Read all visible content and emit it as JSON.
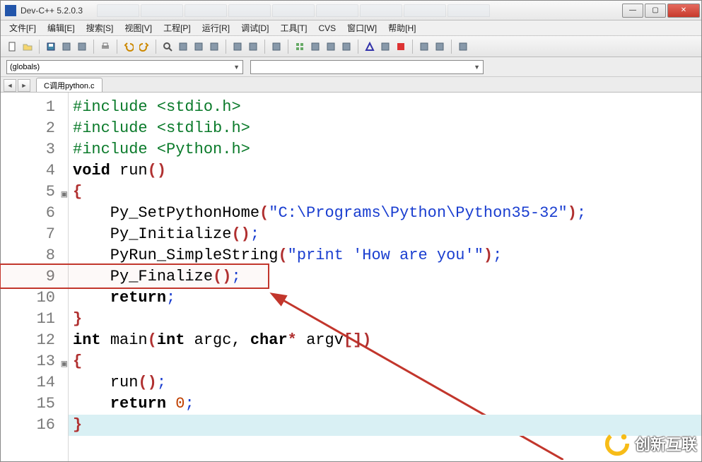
{
  "window": {
    "title": "Dev-C++ 5.2.0.3",
    "min": "—",
    "max": "▢",
    "close": "✕"
  },
  "menu": {
    "file": "文件[F]",
    "edit": "编辑[E]",
    "search": "搜索[S]",
    "view": "视图[V]",
    "project": "工程[P]",
    "run": "运行[R]",
    "debug": "调试[D]",
    "tools": "工具[T]",
    "cvs": "CVS",
    "window": "窗口[W]",
    "help": "帮助[H]"
  },
  "combos": {
    "globals": "(globals)",
    "members": ""
  },
  "tab": {
    "filename": "C调用python.c"
  },
  "lines": [
    {
      "n": "1",
      "fold": false,
      "tokens": [
        [
          "pre",
          "#include "
        ],
        [
          "pre",
          "<stdio.h>"
        ]
      ]
    },
    {
      "n": "2",
      "fold": false,
      "tokens": [
        [
          "pre",
          "#include "
        ],
        [
          "pre",
          "<stdlib.h>"
        ]
      ]
    },
    {
      "n": "3",
      "fold": false,
      "tokens": [
        [
          "pre",
          "#include "
        ],
        [
          "pre",
          "<Python.h>"
        ]
      ]
    },
    {
      "n": "4",
      "fold": false,
      "tokens": [
        [
          "kw",
          "void "
        ],
        [
          "fn",
          "run"
        ],
        [
          "paren",
          "()"
        ]
      ]
    },
    {
      "n": "5",
      "fold": true,
      "tokens": [
        [
          "brace",
          "{"
        ]
      ]
    },
    {
      "n": "6",
      "fold": false,
      "tokens": [
        [
          "ident",
          "    Py_SetPythonHome"
        ],
        [
          "paren",
          "("
        ],
        [
          "str",
          "\"C:\\Programs\\Python\\Python35-32\""
        ],
        [
          "paren",
          ")"
        ],
        [
          "semi",
          ";"
        ]
      ]
    },
    {
      "n": "7",
      "fold": false,
      "tokens": [
        [
          "ident",
          "    Py_Initialize"
        ],
        [
          "paren",
          "()"
        ],
        [
          "semi",
          ";"
        ]
      ]
    },
    {
      "n": "8",
      "fold": false,
      "tokens": [
        [
          "ident",
          "    PyRun_SimpleString"
        ],
        [
          "paren",
          "("
        ],
        [
          "str",
          "\"print 'How are you'\""
        ],
        [
          "paren",
          ")"
        ],
        [
          "semi",
          ";"
        ]
      ]
    },
    {
      "n": "9",
      "fold": false,
      "tokens": [
        [
          "ident",
          "    Py_Finalize"
        ],
        [
          "paren",
          "()"
        ],
        [
          "semi",
          ";"
        ]
      ]
    },
    {
      "n": "10",
      "fold": false,
      "tokens": [
        [
          "kw",
          "    return"
        ],
        [
          "semi",
          ";"
        ]
      ]
    },
    {
      "n": "11",
      "fold": false,
      "tokens": [
        [
          "brace",
          "}"
        ]
      ]
    },
    {
      "n": "12",
      "fold": false,
      "tokens": [
        [
          "kw",
          "int "
        ],
        [
          "fn",
          "main"
        ],
        [
          "paren",
          "("
        ],
        [
          "kw",
          "int "
        ],
        [
          "ident",
          "argc"
        ],
        [
          "ident",
          ", "
        ],
        [
          "kw",
          "char"
        ],
        [
          "paren",
          "* "
        ],
        [
          "ident",
          "argv"
        ],
        [
          "paren",
          "[])"
        ]
      ]
    },
    {
      "n": "13",
      "fold": true,
      "tokens": [
        [
          "brace",
          "{"
        ]
      ]
    },
    {
      "n": "14",
      "fold": false,
      "tokens": [
        [
          "ident",
          "    run"
        ],
        [
          "paren",
          "()"
        ],
        [
          "semi",
          ";"
        ]
      ]
    },
    {
      "n": "15",
      "fold": false,
      "tokens": [
        [
          "kw",
          "    return "
        ],
        [
          "num",
          "0"
        ],
        [
          "semi",
          ";"
        ]
      ]
    },
    {
      "n": "16",
      "fold": false,
      "tokens": [
        [
          "brace",
          "}"
        ]
      ],
      "current": true
    }
  ],
  "highlight": {
    "line_from": 9,
    "line_to": 9
  },
  "tool_icons": [
    "new-file-icon",
    "open-file-icon",
    "sep",
    "save-icon",
    "save-all-icon",
    "save-as-icon",
    "sep",
    "print-icon",
    "sep",
    "undo-icon",
    "redo-icon",
    "sep",
    "find-icon",
    "replace-icon",
    "find-in-files-icon",
    "search-again-icon",
    "sep",
    "back-icon",
    "forward-icon",
    "sep",
    "bookmark-icon",
    "sep",
    "compile-icon",
    "run-icon",
    "compile-run-icon",
    "rebuild-icon",
    "sep",
    "debug-icon",
    "profile-icon",
    "stop-icon",
    "sep",
    "new-project-icon",
    "project-options-icon",
    "sep",
    "goto-line-icon"
  ],
  "watermark": {
    "text": "创新互联"
  }
}
